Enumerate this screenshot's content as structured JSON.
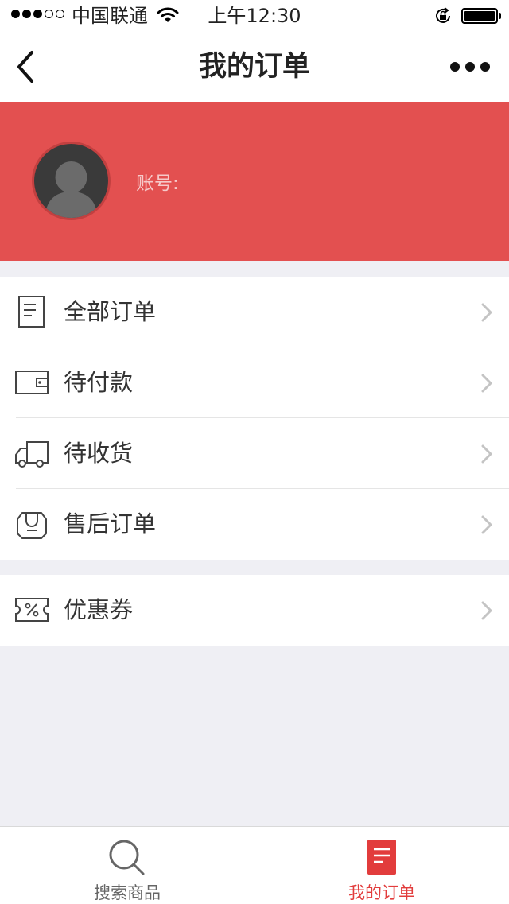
{
  "status_bar": {
    "carrier": "中国联通",
    "time": "上午12:30"
  },
  "nav": {
    "title": "我的订单"
  },
  "profile": {
    "account_label": "账号:"
  },
  "menu": {
    "items": [
      {
        "label": "全部订单",
        "icon": "document-icon"
      },
      {
        "label": "待付款",
        "icon": "wallet-icon"
      },
      {
        "label": "待收货",
        "icon": "truck-icon"
      },
      {
        "label": "售后订单",
        "icon": "return-bag-icon"
      }
    ],
    "coupon": {
      "label": "优惠券",
      "icon": "coupon-icon"
    }
  },
  "tabs": [
    {
      "label": "搜索商品",
      "icon": "search-icon",
      "color": "#666666"
    },
    {
      "label": "我的订单",
      "icon": "order-list-icon",
      "color": "#e23c3c",
      "active": true
    }
  ],
  "colors": {
    "accent": "#e35050",
    "tab_active": "#e23c3c",
    "background": "#efeff4"
  }
}
